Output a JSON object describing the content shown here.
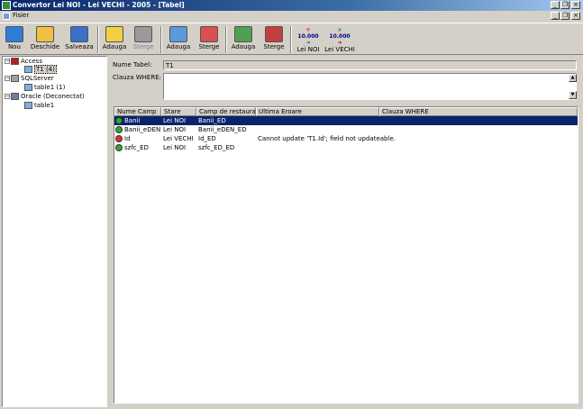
{
  "window": {
    "title": "Convertor Lei NOI - Lei VECHI - 2005 - [Tabel]",
    "controls": [
      "_",
      "❐",
      "×"
    ],
    "mdi_controls": [
      "_",
      "❐",
      "×"
    ]
  },
  "menu": {
    "items": [
      "Fisier"
    ]
  },
  "toolbar": {
    "buttons": [
      {
        "label": "Nou",
        "icon": "new-doc-icon",
        "color": "#2e7dd8"
      },
      {
        "label": "Deschide",
        "icon": "open-folder-icon",
        "color": "#f0c040"
      },
      {
        "label": "Salveaza",
        "icon": "save-disk-icon",
        "color": "#3a70c8"
      },
      {
        "label": "Adauga",
        "icon": "add-db-icon",
        "color": "#f0d040"
      },
      {
        "label": "Sterge",
        "icon": "delete-db-icon",
        "color": "#9a9a9a"
      },
      {
        "label": "Adauga",
        "icon": "add-table-icon",
        "color": "#5a9ad8"
      },
      {
        "label": "Sterge",
        "icon": "delete-table-icon",
        "color": "#d85050"
      },
      {
        "label": "Adauga",
        "icon": "add-field-icon",
        "color": "#50a050"
      },
      {
        "label": "Sterge",
        "icon": "delete-field-icon",
        "color": "#c04040"
      },
      {
        "label": "Lei NOI",
        "icon": "convert-new-icon",
        "num": "10.000"
      },
      {
        "label": "Lei VECHI",
        "icon": "convert-old-icon",
        "num": "10.000"
      }
    ],
    "disabled_label": "Sterge"
  },
  "tree": {
    "nodes": [
      {
        "label": "Access",
        "toggle": "−"
      },
      {
        "label": "T1 (4)"
      },
      {
        "label": "SQLServer",
        "toggle": "−"
      },
      {
        "label": "table1 (1)"
      },
      {
        "label": "Oracle (Deconectat)",
        "toggle": "−"
      },
      {
        "label": "table1"
      }
    ]
  },
  "form": {
    "table_name_label": "Nume Tabel:",
    "table_name_value": "T1",
    "where_label": "Clauza WHERE:",
    "where_value": ""
  },
  "grid": {
    "headers": [
      "Nume Camp",
      "Stare",
      "Camp de restaurare",
      "Ultima Eroare",
      "Clauza WHERE"
    ],
    "rows": [
      {
        "name": "Banii",
        "state": "Lei NOI",
        "restore": "Banii_ED",
        "error": "",
        "where": "",
        "status_color": "#2fa82f"
      },
      {
        "name": "Banii_eDEN",
        "state": "Lei NOI",
        "restore": "Banii_eDEN_ED",
        "error": "",
        "where": "",
        "status_color": "#2fa82f"
      },
      {
        "name": "Id",
        "state": "Lei VECHI",
        "restore": "Id_ED",
        "error": "Cannot update 'T1.Id'; field not updateable.",
        "where": "",
        "status_color": "#e03030"
      },
      {
        "name": "szfc_ED",
        "state": "Lei NOI",
        "restore": "szfc_ED_ED",
        "error": "",
        "where": "",
        "status_color": "#2fa82f"
      }
    ]
  }
}
